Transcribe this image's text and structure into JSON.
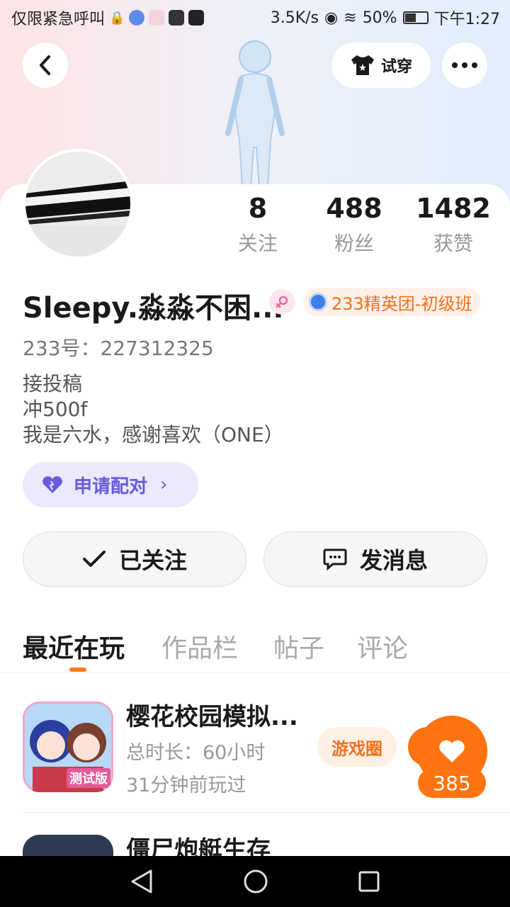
{
  "status_bar": {
    "carrier": "仅限紧急呼叫",
    "speed": "3.5K/s",
    "battery": "50%",
    "time": "下午1:27"
  },
  "top_nav": {
    "tryon_label": "试穿"
  },
  "profile": {
    "stats": [
      {
        "value": "8",
        "label": "关注"
      },
      {
        "value": "488",
        "label": "粉丝"
      },
      {
        "value": "1482",
        "label": "获赞"
      }
    ],
    "username": "Sleepy.淼淼不困...",
    "group_badge": "233精英团-初级班",
    "uid": "233号：227312325",
    "bio": [
      "接投稿",
      "冲500f",
      "我是六水，感谢喜欢（ONE）"
    ],
    "pair_button": "申请配对",
    "follow_button": "已关注",
    "message_button": "发消息"
  },
  "tabs": [
    "最近在玩",
    "作品栏",
    "帖子",
    "评论"
  ],
  "games": [
    {
      "title": "樱花校园模拟...",
      "playtime": "总时长：60小时",
      "last_played": "31分钟前玩过",
      "circle_label": "游戏圈",
      "icon_text": "测试版"
    },
    {
      "title": "僵尸炮艇生存"
    }
  ],
  "like_count": "385",
  "colors": {
    "accent": "#ff7410",
    "pair": "#6a5adf",
    "badge": "#f2721c"
  }
}
